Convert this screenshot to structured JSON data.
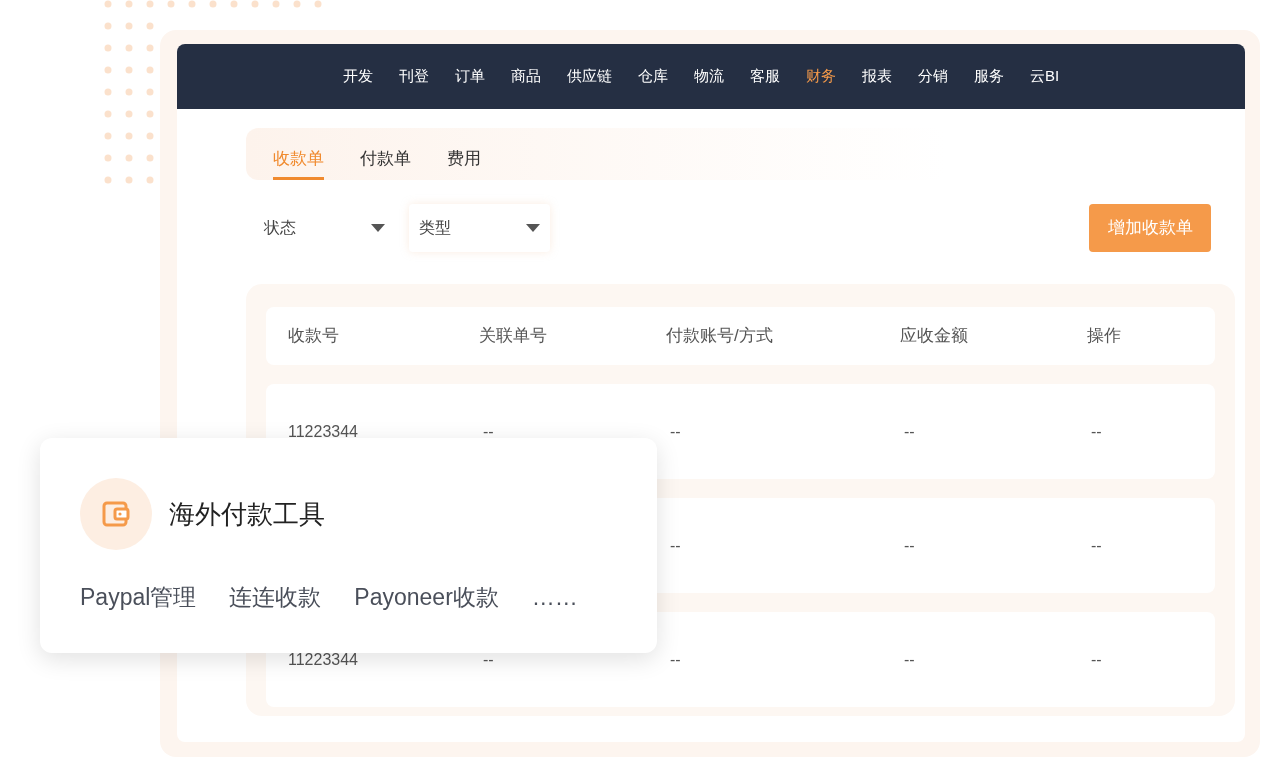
{
  "nav": {
    "items": [
      {
        "label": "开发",
        "selected": false
      },
      {
        "label": "刊登",
        "selected": false
      },
      {
        "label": "订单",
        "selected": false
      },
      {
        "label": "商品",
        "selected": false
      },
      {
        "label": "供应链",
        "selected": false
      },
      {
        "label": "仓库",
        "selected": false
      },
      {
        "label": "物流",
        "selected": false
      },
      {
        "label": "客服",
        "selected": false
      },
      {
        "label": "财务",
        "selected": true
      },
      {
        "label": "报表",
        "selected": false
      },
      {
        "label": "分销",
        "selected": false
      },
      {
        "label": "服务",
        "selected": false
      },
      {
        "label": "云BI",
        "selected": false
      }
    ]
  },
  "tabs": [
    {
      "label": "收款单",
      "selected": true
    },
    {
      "label": "付款单",
      "selected": false
    },
    {
      "label": "费用",
      "selected": false
    }
  ],
  "filters": [
    {
      "label": "状态"
    },
    {
      "label": "类型"
    }
  ],
  "add_button": "增加收款单",
  "table": {
    "columns": [
      "收款号",
      "关联单号",
      "付款账号/方式",
      "应收金额",
      "操作"
    ],
    "rows": [
      {
        "cells": [
          "11223344",
          "--",
          "--",
          "--",
          "--"
        ]
      },
      {
        "cells": [
          null,
          null,
          "--",
          "--",
          "--"
        ]
      },
      {
        "cells": [
          "11223344",
          "--",
          "--",
          "--",
          "--"
        ]
      }
    ]
  },
  "tool_card": {
    "title": "海外付款工具",
    "links": [
      "Paypal管理",
      "连连收款",
      "Payoneer收款",
      "……"
    ]
  }
}
